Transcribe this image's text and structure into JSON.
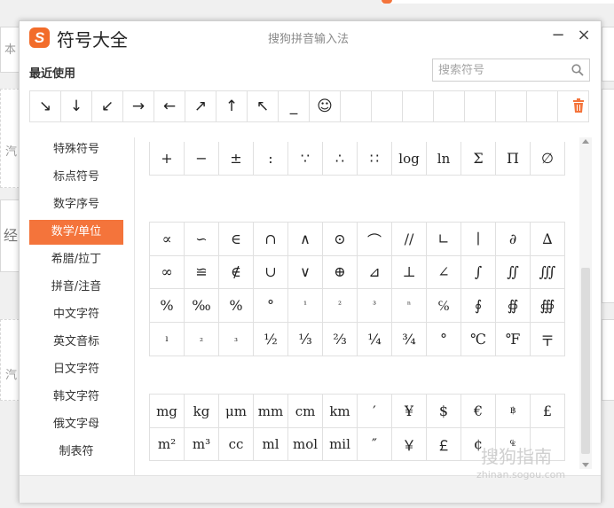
{
  "window": {
    "title": "符号大全",
    "logo": "S",
    "ime_name": "搜狗拼音输入法",
    "minimize": "−",
    "close": "×"
  },
  "recent": {
    "label": "最近使用",
    "symbols": [
      "↘",
      "↓",
      "↙",
      "→",
      "←",
      "↗",
      "↑",
      "↖",
      "_",
      "☺",
      "",
      "",
      "",
      "",
      "",
      "",
      "",
      ""
    ]
  },
  "search": {
    "placeholder": "搜索符号"
  },
  "sidebar": {
    "items": [
      {
        "label": "特殊符号"
      },
      {
        "label": "标点符号"
      },
      {
        "label": "数字序号"
      },
      {
        "label": "数学/单位"
      },
      {
        "label": "希腊/拉丁"
      },
      {
        "label": "拼音/注音"
      },
      {
        "label": "中文字符"
      },
      {
        "label": "英文音标"
      },
      {
        "label": "日文字符"
      },
      {
        "label": "韩文字符"
      },
      {
        "label": "俄文字母"
      },
      {
        "label": "制表符"
      }
    ],
    "active_index": 3,
    "accent": "#f4743b"
  },
  "grid": {
    "row0": [
      "+",
      "−",
      "±",
      ":",
      "∵",
      "∴",
      "∷",
      "log",
      "ln",
      "Σ",
      "Π",
      "∅"
    ],
    "row1": [
      "∝",
      "∽",
      "∈",
      "∩",
      "∧",
      "⊙",
      "⌒",
      "//",
      "∟",
      "∣",
      "∂",
      "∆"
    ],
    "row2": [
      "∞",
      "≌",
      "∉",
      "∪",
      "∨",
      "⊕",
      "⊿",
      "⊥",
      "∠",
      "∫",
      "∬",
      "∭"
    ],
    "row3": [
      "%",
      "‰",
      "%",
      "°",
      "¹",
      "²",
      "³",
      "ⁿ",
      "℅",
      "∮",
      "∯",
      "∰"
    ],
    "row4": [
      "ı",
      "₂",
      "₃",
      "½",
      "⅓",
      "⅔",
      "¼",
      "¾",
      "°",
      "℃",
      "℉",
      "〒"
    ],
    "row5": [
      "mg",
      "kg",
      "μm",
      "mm",
      "cm",
      "km",
      "′",
      "¥",
      "$",
      "€",
      "฿",
      "£"
    ],
    "row6": [
      "m²",
      "m³",
      "cc",
      "ml",
      "mol",
      "mil",
      "″",
      "￥",
      "￡",
      "¢",
      "₠",
      ""
    ]
  },
  "watermark": {
    "brand": "搜狗指南",
    "url": "zhinan.sogou.com"
  },
  "background": {
    "frag1": "本",
    "frag2": "汽",
    "frag3": "经",
    "frag4": "汽"
  }
}
